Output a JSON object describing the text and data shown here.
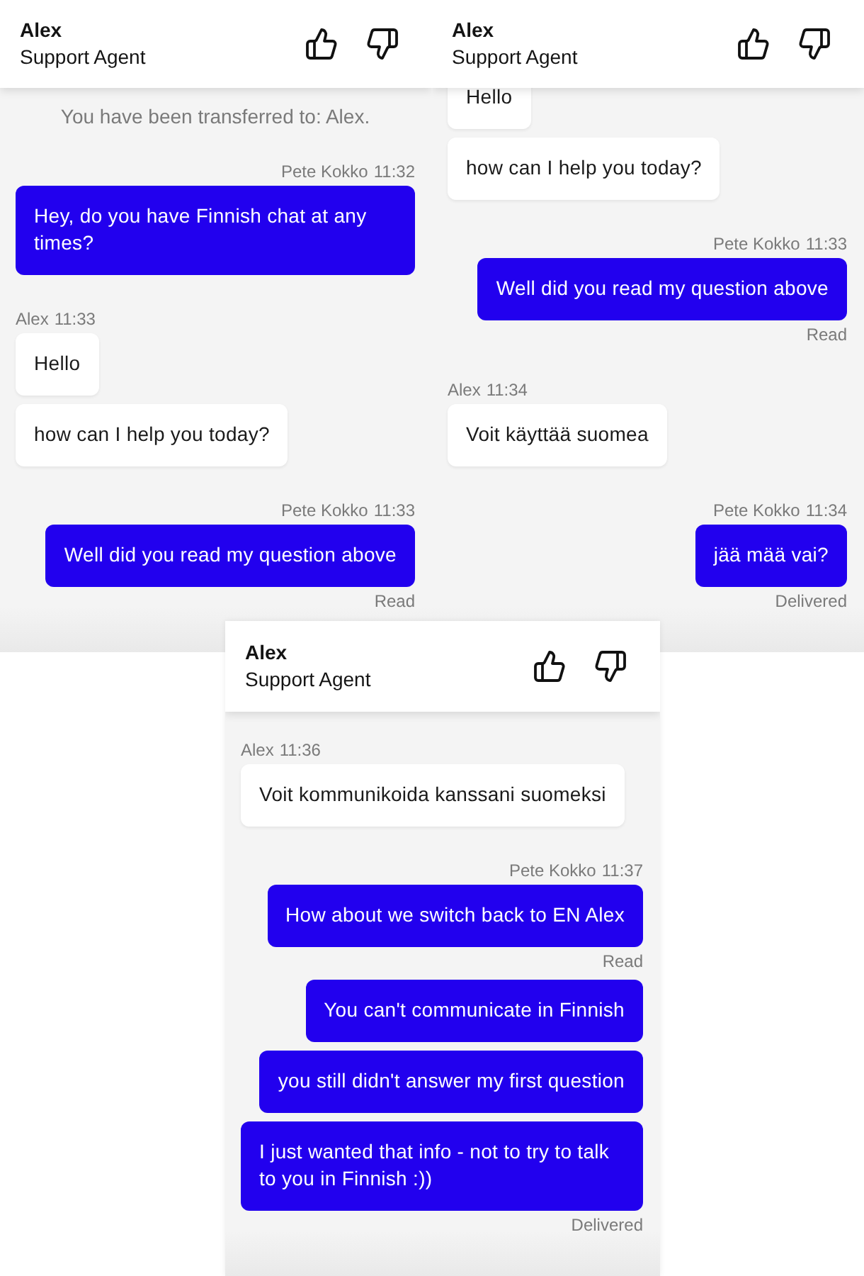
{
  "panels": [
    {
      "header": {
        "name": "Alex",
        "role": "Support Agent"
      },
      "feed": [
        {
          "kind": "notice",
          "text": "You have been transferred to: Alex."
        },
        {
          "kind": "user",
          "sender": "Pete Kokko",
          "time": "11:32",
          "bubbles": [
            "Hey, do you have Finnish chat at any times?"
          ]
        },
        {
          "kind": "agent",
          "sender": "Alex",
          "time": "11:33",
          "bubbles": [
            "Hello",
            "how can I help you today?"
          ]
        },
        {
          "kind": "user",
          "sender": "Pete Kokko",
          "time": "11:33",
          "bubbles": [
            "Well did you read my question above"
          ],
          "status": "Read"
        }
      ]
    },
    {
      "header": {
        "name": "Alex",
        "role": "Support Agent"
      },
      "feed": [
        {
          "kind": "agent",
          "bubbles": [
            "Hello",
            "how can I help you today?"
          ]
        },
        {
          "kind": "user",
          "sender": "Pete Kokko",
          "time": "11:33",
          "bubbles": [
            "Well did you read my question above"
          ],
          "status": "Read"
        },
        {
          "kind": "agent",
          "sender": "Alex",
          "time": "11:34",
          "bubbles": [
            "Voit käyttää suomea"
          ]
        },
        {
          "kind": "user",
          "sender": "Pete Kokko",
          "time": "11:34",
          "bubbles": [
            "jää mää vai?"
          ],
          "status": "Delivered"
        }
      ]
    },
    {
      "header": {
        "name": "Alex",
        "role": "Support Agent"
      },
      "feed": [
        {
          "kind": "agent",
          "sender": "Alex",
          "time": "11:36",
          "bubbles": [
            "Voit kommunikoida kanssani suomeksi"
          ]
        },
        {
          "kind": "user",
          "sender": "Pete Kokko",
          "time": "11:37",
          "bubbles": [
            "How about we switch back to EN Alex"
          ],
          "status": "Read"
        },
        {
          "kind": "user",
          "bubbles": [
            "You can't communicate in Finnish",
            "you still didn't answer my first question",
            "I just wanted that info - not to try to talk to you in Finnish :))"
          ],
          "status": "Delivered"
        }
      ]
    }
  ]
}
